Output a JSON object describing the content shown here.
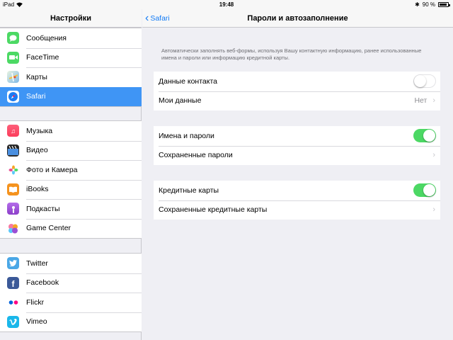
{
  "status_bar": {
    "device": "iPad",
    "time": "19:48",
    "battery_text": "90 %",
    "battery_level": 0.9
  },
  "sidebar": {
    "title": "Настройки",
    "groups": [
      [
        {
          "label": "Сообщения",
          "icon": "messages-icon",
          "color": "#4cd964"
        },
        {
          "label": "FaceTime",
          "icon": "facetime-icon",
          "color": "#4cd964"
        },
        {
          "label": "Карты",
          "icon": "maps-icon",
          "color": "#7fb8e6"
        },
        {
          "label": "Safari",
          "icon": "safari-icon",
          "color": "#1d7cf2",
          "selected": true
        }
      ],
      [
        {
          "label": "Музыка",
          "icon": "music-icon",
          "color": "#fc3d5b"
        },
        {
          "label": "Видео",
          "icon": "video-icon",
          "color": "#3b6fb8"
        },
        {
          "label": "Фото и Камера",
          "icon": "photos-icon",
          "color": "#f5a623"
        },
        {
          "label": "iBooks",
          "icon": "ibooks-icon",
          "color": "#f5931e"
        },
        {
          "label": "Подкасты",
          "icon": "podcasts-icon",
          "color": "#9b4fd4"
        },
        {
          "label": "Game Center",
          "icon": "game-center-icon",
          "color": "#e94c8e"
        }
      ],
      [
        {
          "label": "Twitter",
          "icon": "twitter-icon",
          "color": "#4aa7e6"
        },
        {
          "label": "Facebook",
          "icon": "facebook-icon",
          "color": "#3b5998"
        },
        {
          "label": "Flickr",
          "icon": "flickr-icon",
          "color": "#ffffff"
        },
        {
          "label": "Vimeo",
          "icon": "vimeo-icon",
          "color": "#1ab7ea"
        }
      ]
    ]
  },
  "detail": {
    "back_label": "Safari",
    "title": "Пароли и автозаполнение",
    "description": "Автоматически заполнять веб-формы, используя Вашу контактную информацию, ранее использованные имена и пароли или информацию кредитной карты.",
    "groups": [
      [
        {
          "label": "Данные контакта",
          "type": "toggle",
          "on": false
        },
        {
          "label": "Мои данные",
          "type": "link",
          "value": "Нет"
        }
      ],
      [
        {
          "label": "Имена и пароли",
          "type": "toggle",
          "on": true
        },
        {
          "label": "Сохраненные пароли",
          "type": "link",
          "value": ""
        }
      ],
      [
        {
          "label": "Кредитные карты",
          "type": "toggle",
          "on": true
        },
        {
          "label": "Сохраненные кредитные карты",
          "type": "link",
          "value": ""
        }
      ]
    ]
  },
  "colors": {
    "accent": "#127bf5",
    "selection": "#3f95f5",
    "toggle_on": "#4cd864"
  }
}
